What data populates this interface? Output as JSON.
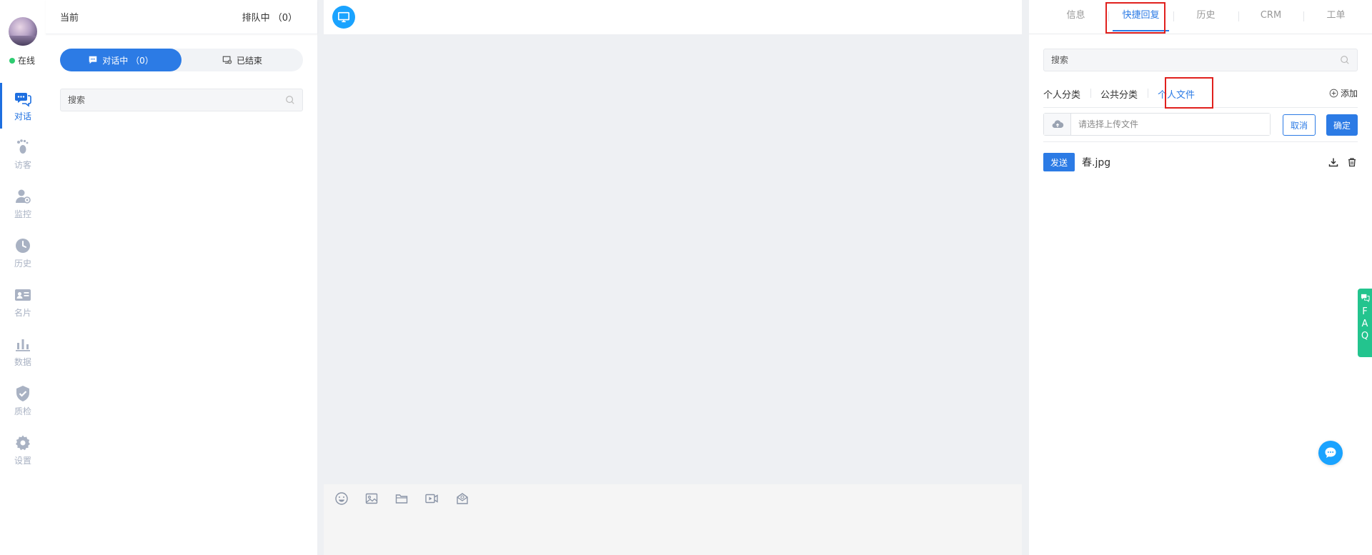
{
  "nav": {
    "status": "在线",
    "items": [
      {
        "label": "对话",
        "icon": "chat-icon"
      },
      {
        "label": "访客",
        "icon": "footprint-icon"
      },
      {
        "label": "监控",
        "icon": "monitor-user-icon"
      },
      {
        "label": "历史",
        "icon": "clock-icon"
      },
      {
        "label": "名片",
        "icon": "id-card-icon"
      },
      {
        "label": "数据",
        "icon": "bar-chart-icon"
      },
      {
        "label": "质检",
        "icon": "shield-check-icon"
      },
      {
        "label": "设置",
        "icon": "gear-icon"
      }
    ]
  },
  "list": {
    "current_label": "当前",
    "queue_label": "排队中 （0）",
    "seg_active": "对话中 （0）",
    "seg_ended": "已结束",
    "search_placeholder": "搜索"
  },
  "right": {
    "tabs": [
      "信息",
      "快捷回复",
      "历史",
      "CRM",
      "工单"
    ],
    "search_placeholder": "搜索",
    "sub_tabs": [
      "个人分类",
      "公共分类",
      "个人文件"
    ],
    "add_label": "添加",
    "upload_placeholder": "请选择上传文件",
    "cancel_label": "取消",
    "ok_label": "确定",
    "files": [
      {
        "send_label": "发送",
        "name": "春.jpg"
      }
    ]
  },
  "faq": [
    "F",
    "A",
    "Q"
  ],
  "colors": {
    "accent": "#2c7be5",
    "online": "#2ecc71",
    "faq": "#23c48e",
    "highlight": "#e0201d"
  }
}
